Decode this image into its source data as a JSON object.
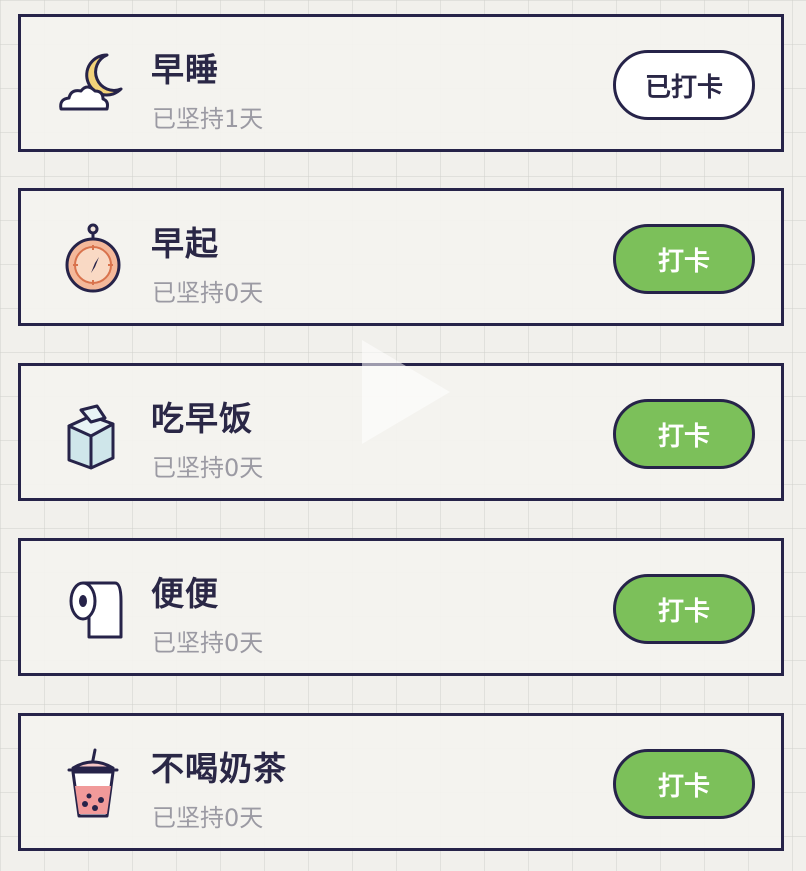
{
  "habits": [
    {
      "title": "早睡",
      "status": "已坚持1天",
      "button_label": "已打卡",
      "checked_in": true,
      "icon": "moon-cloud-icon"
    },
    {
      "title": "早起",
      "status": "已坚持0天",
      "button_label": "打卡",
      "checked_in": false,
      "icon": "stopwatch-icon"
    },
    {
      "title": "吃早饭",
      "status": "已坚持0天",
      "button_label": "打卡",
      "checked_in": false,
      "icon": "milk-carton-icon"
    },
    {
      "title": "便便",
      "status": "已坚持0天",
      "button_label": "打卡",
      "checked_in": false,
      "icon": "toilet-paper-icon"
    },
    {
      "title": "不喝奶茶",
      "status": "已坚持0天",
      "button_label": "打卡",
      "checked_in": false,
      "icon": "bubble-tea-icon"
    }
  ],
  "colors": {
    "outline": "#262349",
    "checkin_button": "#7cc05a",
    "checked_button": "#ffffff",
    "title_text": "#2a2746",
    "subtitle_text": "#9b9aa3"
  }
}
